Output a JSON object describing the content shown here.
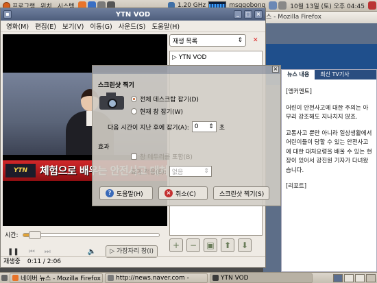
{
  "top_panel": {
    "menus": [
      "프로그램",
      "위치",
      "시스템"
    ],
    "cpu_freq": "1.20 GHz",
    "user": "msggobong",
    "clock": "10월 13일 (토) 오후 04:45"
  },
  "firefox": {
    "title": "스 - Mozilla Firefox",
    "tabs": [
      "뉴스 내용",
      "최신 TV기사"
    ],
    "paragraphs": [
      "[앵커멘트]",
      "어린이 안전사고에 대한 주의는 아무리 강조해도 지나치지 않죠.",
      "교통사고 뿐만 아니라 일상생활에서 어린이들이 당할 수 있는 안전사고에 대한 대처요령을 배울 수 있는 현장이 있어서 강진원 기자가 다녀왔습니다.",
      "[리포트]"
    ]
  },
  "vod": {
    "title": "YTN VOD",
    "menus": [
      "영화(M)",
      "편집(E)",
      "보기(V)",
      "이동(G)",
      "사운드(S)",
      "도움말(H)"
    ],
    "caption_logo": "YTN",
    "caption": "체험으로 배우는 안전사고 대처",
    "playlist_select": "재생 목록",
    "playlist_items": [
      "YTN VOD"
    ],
    "time_label": "시간:",
    "fullscreen_label": "가장자리 창(I)",
    "status": "재생중",
    "position": "0:11 / 2:06",
    "progress": 0.087
  },
  "dialog": {
    "heading": "스크린샷 찍기",
    "option_desktop": "전체 데스크탑 잡기(D)",
    "option_window": "현재 창 잡기(W)",
    "delay_label": "다음 시간이 지난 후에 잡기(A):",
    "delay_value": "0",
    "delay_unit": "초",
    "effects_heading": "효과",
    "border_option": "창 테두리를 포함(B)",
    "effect_label": "효과 적용(E):",
    "effect_value": "없음",
    "help_button": "도움말(H)",
    "cancel_button": "취소(C)",
    "shot_button": "스크린샷 찍기(S)"
  },
  "taskbar": {
    "tasks": [
      "네이버 뉴스 - Mozilla Firefox",
      "http://news.naver.com -",
      "YTN VOD"
    ]
  }
}
